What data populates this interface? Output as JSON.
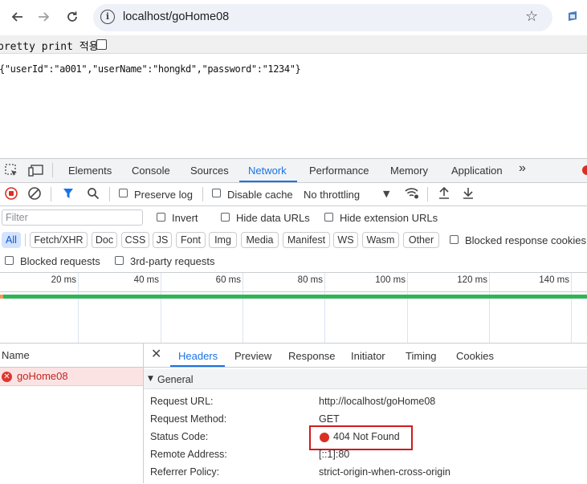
{
  "browser": {
    "url": "localhost/goHome08",
    "back_icon": "arrow-left-icon",
    "forward_icon": "arrow-right-icon",
    "reload_icon": "reload-icon",
    "info_icon": "info-icon",
    "star_icon": "star-icon"
  },
  "page": {
    "pretty_print_label": "pretty print 적용",
    "json_text": "{\"userId\":\"a001\",\"userName\":\"hongkd\",\"password\":\"1234\"}"
  },
  "devtools": {
    "tabs": [
      "Elements",
      "Console",
      "Sources",
      "Network",
      "Performance",
      "Memory",
      "Application"
    ],
    "active_tab": "Network",
    "more_tabs": "»",
    "toolbar": {
      "preserve_log": "Preserve log",
      "disable_cache": "Disable cache",
      "throttling": "No throttling"
    },
    "filter": {
      "placeholder": "Filter",
      "invert": "Invert",
      "hide_data_urls": "Hide data URLs",
      "hide_extension_urls": "Hide extension URLs"
    },
    "type_chips": [
      "All",
      "Fetch/XHR",
      "Doc",
      "CSS",
      "JS",
      "Font",
      "Img",
      "Media",
      "Manifest",
      "WS",
      "Wasm",
      "Other"
    ],
    "blocked_response_cookies": "Blocked response cookies",
    "blocked_requests": "Blocked requests",
    "third_party_requests": "3rd-party requests",
    "timeline_ticks": [
      "20 ms",
      "40 ms",
      "60 ms",
      "80 ms",
      "100 ms",
      "120 ms",
      "140 ms"
    ],
    "request_list": {
      "header": "Name",
      "rows": [
        {
          "name": "goHome08",
          "status": "error"
        }
      ]
    },
    "detail_tabs": [
      "Headers",
      "Preview",
      "Response",
      "Initiator",
      "Timing",
      "Cookies"
    ],
    "active_detail_tab": "Headers",
    "general": {
      "title": "General",
      "rows": [
        {
          "key": "Request URL:",
          "value": "http://localhost/goHome08"
        },
        {
          "key": "Request Method:",
          "value": "GET"
        },
        {
          "key": "Status Code:",
          "value": "404 Not Found"
        },
        {
          "key": "Remote Address:",
          "value": "[::1]:80"
        },
        {
          "key": "Referrer Policy:",
          "value": "strict-origin-when-cross-origin"
        }
      ]
    },
    "colors": {
      "accent": "#1a73e8",
      "error": "#d93025",
      "highlight_box": "#d21a1a",
      "waterfall": "#2fb457"
    }
  }
}
